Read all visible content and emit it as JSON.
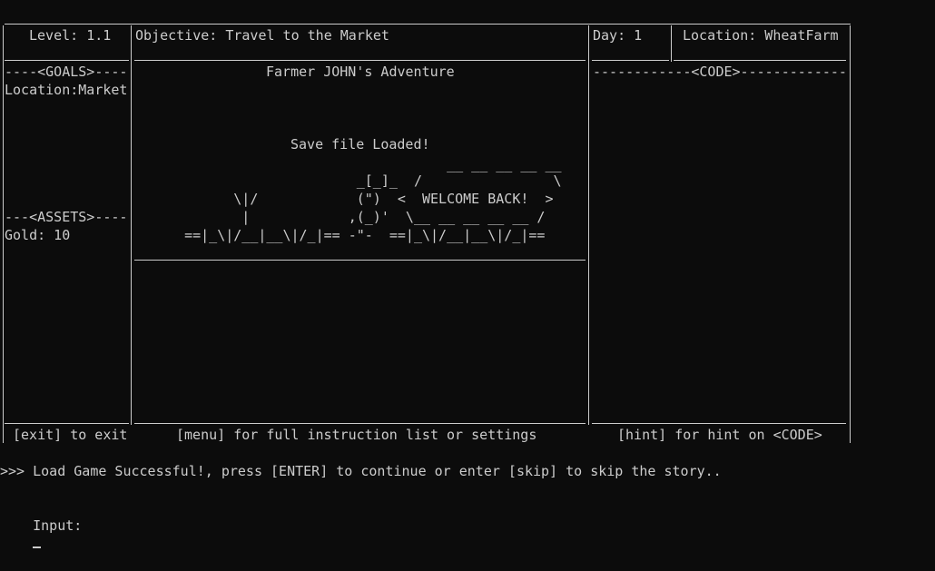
{
  "status": {
    "level": "Level: 1.1",
    "objective": "Objective: Travel to the Market",
    "day": "Day: 1",
    "location": "Location: WheatFarm"
  },
  "goals": {
    "header": "----<GOALS>----",
    "item": "Location:Market"
  },
  "assets": {
    "header": "---<ASSETS>----",
    "gold": "Gold: 10"
  },
  "main": {
    "title": "Farmer JOHN's Adventure",
    "message": "Save file Loaded!",
    "art": [
      "                                   __ __ __ __ __",
      "                        _[_]_  /                \\",
      "         \\|/            (\")  <  WELCOME BACK!  >",
      "          |            ,(_)'  \\__ __ __ __ __ /",
      "   ==|_\\|/__|__\\|/_|== -\"-  ==|_\\|/__|__\\|/_|=="
    ]
  },
  "code": {
    "header": "------------<CODE>-------------"
  },
  "footer": {
    "exit": "[exit] to exit",
    "menu": "[menu] for full instruction list or settings",
    "hint": "[hint] for hint on <CODE>"
  },
  "console": {
    "message": ">>> Load Game Successful!, press [ENTER] to continue or enter [skip] to skip the story..",
    "prompt": "Input:"
  }
}
